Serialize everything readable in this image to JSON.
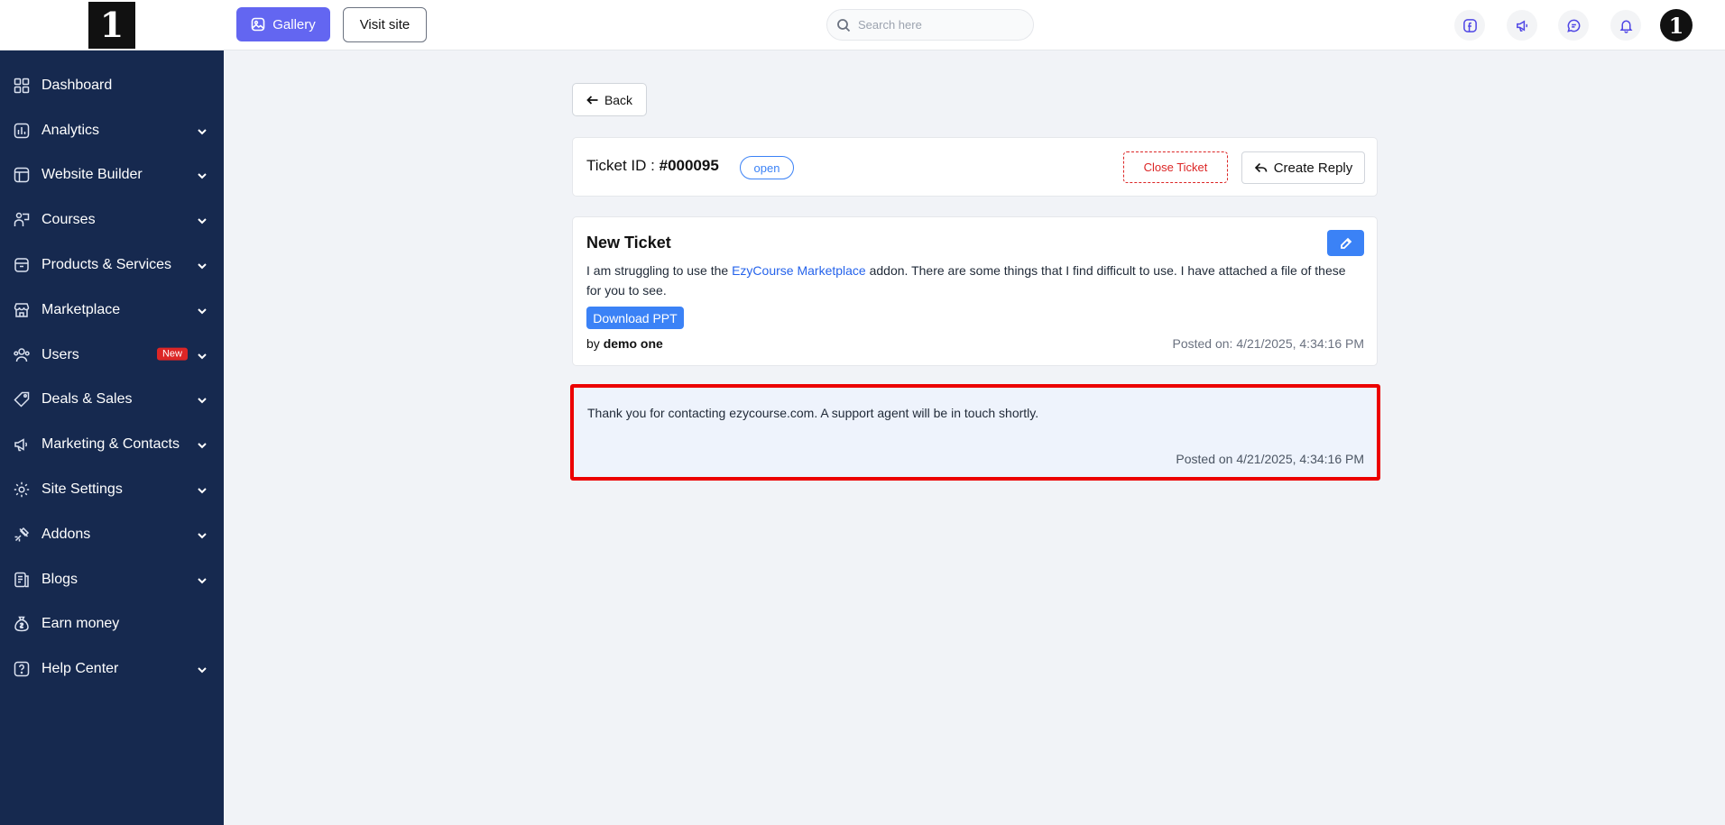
{
  "logo": {
    "text": "1"
  },
  "sidebar": {
    "items": [
      {
        "label": "Dashboard",
        "icon": "grid-icon",
        "chevron": false,
        "badge": ""
      },
      {
        "label": "Analytics",
        "icon": "bar-chart-icon",
        "chevron": true,
        "badge": ""
      },
      {
        "label": "Website Builder",
        "icon": "layout-icon",
        "chevron": true,
        "badge": ""
      },
      {
        "label": "Courses",
        "icon": "teacher-icon",
        "chevron": true,
        "badge": ""
      },
      {
        "label": "Products & Services",
        "icon": "box-icon",
        "chevron": true,
        "badge": ""
      },
      {
        "label": "Marketplace",
        "icon": "store-icon",
        "chevron": true,
        "badge": ""
      },
      {
        "label": "Users",
        "icon": "users-icon",
        "chevron": true,
        "badge": "New"
      },
      {
        "label": "Deals & Sales",
        "icon": "tag-icon",
        "chevron": true,
        "badge": ""
      },
      {
        "label": "Marketing & Contacts",
        "icon": "megaphone-icon",
        "chevron": true,
        "badge": ""
      },
      {
        "label": "Site Settings",
        "icon": "gear-icon",
        "chevron": true,
        "badge": ""
      },
      {
        "label": "Addons",
        "icon": "plug-icon",
        "chevron": true,
        "badge": ""
      },
      {
        "label": "Blogs",
        "icon": "document-icon",
        "chevron": true,
        "badge": ""
      },
      {
        "label": "Earn money",
        "icon": "money-bag-icon",
        "chevron": false,
        "badge": ""
      },
      {
        "label": "Help Center",
        "icon": "help-icon",
        "chevron": true,
        "badge": ""
      }
    ]
  },
  "topbar": {
    "gallery_label": "Gallery",
    "visit_label": "Visit site",
    "search_placeholder": "Search here",
    "icons": [
      "facebook-icon",
      "megaphone-icon",
      "chat-icon",
      "bell-icon"
    ],
    "avatar_text": "1"
  },
  "main": {
    "back_label": "Back",
    "ticket": {
      "id_prefix": "Ticket ID : ",
      "id": "#000095",
      "status": "open",
      "close_label": "Close Ticket",
      "reply_label": "Create Reply",
      "title": "New Ticket",
      "text_before": "I am struggling to use the ",
      "link_text": "EzyCourse Marketplace",
      "text_after": " addon. There are some things that I find difficult to use. I have attached a file of these for you to see.",
      "download_label": "Download PPT",
      "by_prefix": "by ",
      "author": "demo one",
      "posted": "Posted on: 4/21/2025, 4:34:16 PM"
    },
    "reply": {
      "text": "Thank you for contacting ezycourse.com. A support agent will be in touch shortly.",
      "posted": "Posted on 4/21/2025, 4:34:16 PM"
    }
  },
  "colors": {
    "sidebar_bg": "#16294f",
    "accent": "#6366f1",
    "primary_blue": "#3b82f6",
    "danger": "#dc2626",
    "highlight_border": "#ec0000"
  }
}
